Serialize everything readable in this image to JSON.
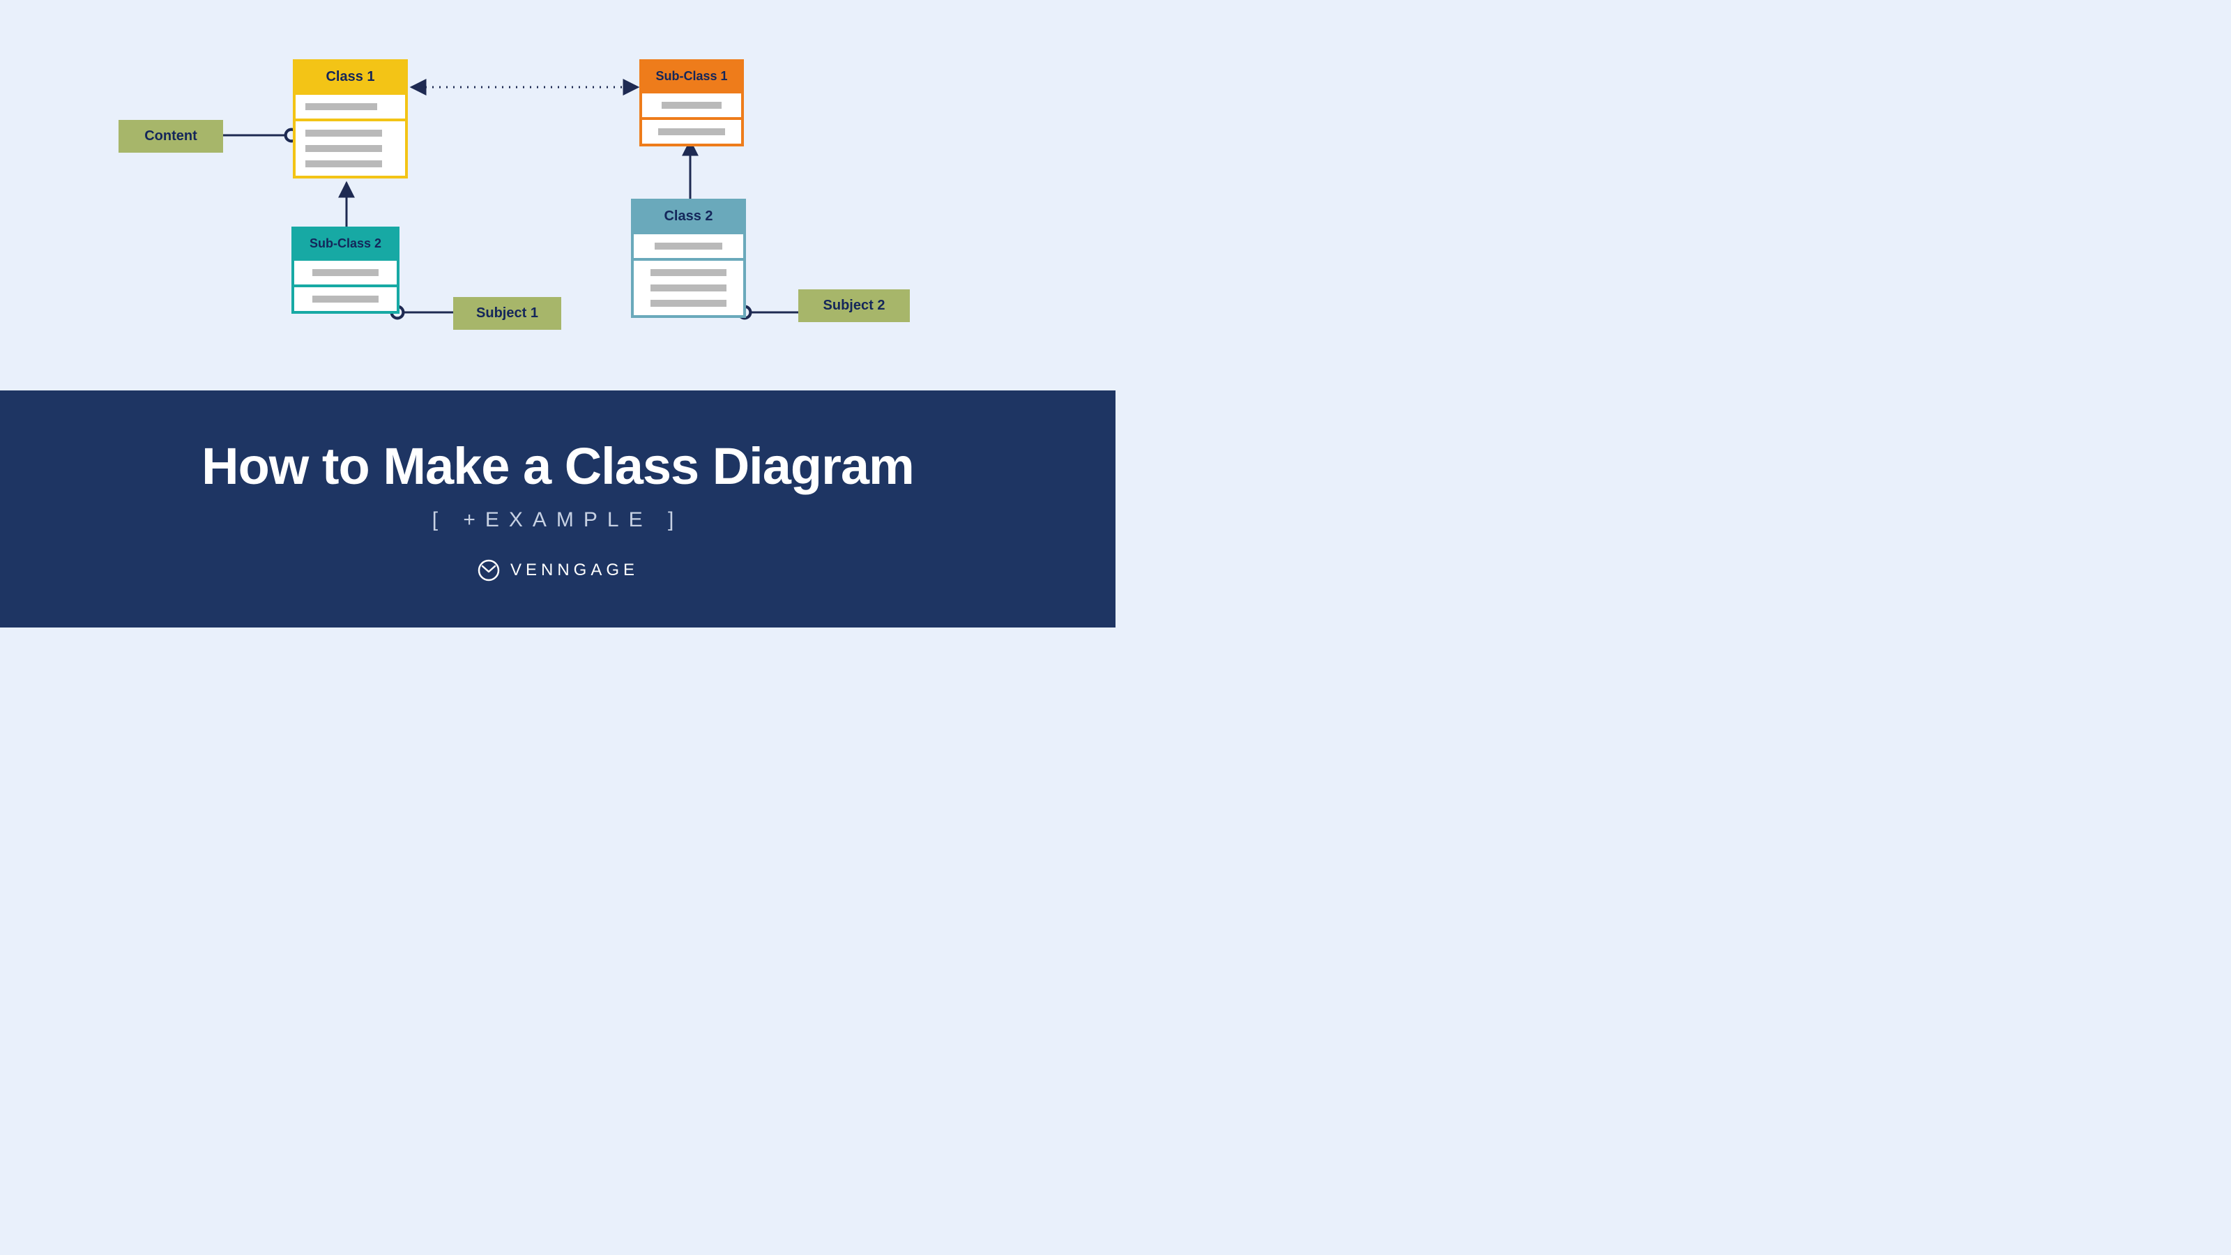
{
  "diagram": {
    "boxes": {
      "class1": {
        "title": "Class 1"
      },
      "subclass2": {
        "title": "Sub-Class 2"
      },
      "subclass1": {
        "title": "Sub-Class 1"
      },
      "class2": {
        "title": "Class 2"
      }
    },
    "pills": {
      "content": "Content",
      "subject1": "Subject 1",
      "subject2": "Subject 2"
    },
    "connectors": {
      "dotted_between": "association (dotted, bidirectional)",
      "arrow_subclass2_to_class1": "inheritance",
      "arrow_class2_to_subclass1": "inheritance",
      "content_to_class1": "note-link",
      "subject1_to_subclass2": "note-link",
      "subject2_to_class2": "note-link"
    }
  },
  "footer": {
    "title": "How to Make a Class Diagram",
    "subtitle": "[ +EXAMPLE ]",
    "brand": "VENNGAGE"
  },
  "colors": {
    "canvas_bg": "#e9f0fb",
    "footer_bg": "#1e3563",
    "text_dark": "#14265a",
    "pill": "#a7b66a",
    "yellow": "#f3c416",
    "teal": "#17a9a4",
    "orange": "#ee7c1b",
    "steel": "#6aa9bb",
    "bar": "#b9b9b9",
    "connector": "#1e2a52"
  }
}
